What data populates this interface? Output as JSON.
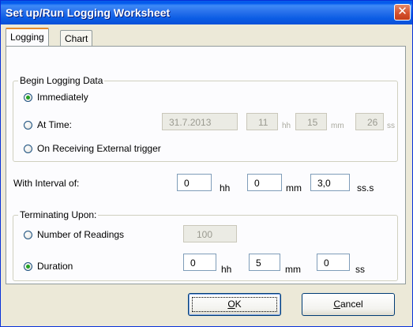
{
  "window": {
    "title": "Set up/Run Logging Worksheet",
    "close_glyph": "✕",
    "close_icon": "close-icon"
  },
  "tabs": [
    {
      "label": "Logging",
      "active": true
    },
    {
      "label": "Chart",
      "active": false
    }
  ],
  "begin_group": {
    "legend": "Begin Logging Data",
    "options": [
      {
        "label": "Immediately",
        "selected": true
      },
      {
        "label": "At Time:",
        "selected": false
      },
      {
        "label": "On Receiving External trigger",
        "selected": false
      }
    ],
    "at_time": {
      "date": "31.7.2013",
      "hh": "11",
      "hh_unit": "hh",
      "mm": "15",
      "mm_unit": "mm",
      "ss": "26",
      "ss_unit": "ss"
    }
  },
  "interval": {
    "label": "With Interval of:",
    "hh": "0",
    "hh_unit": "hh",
    "mm": "0",
    "mm_unit": "mm",
    "ss": "3,0",
    "ss_unit": "ss.s"
  },
  "terminate_group": {
    "legend": "Terminating Upon:",
    "options": [
      {
        "label": "Number of Readings",
        "selected": false
      },
      {
        "label": "Duration",
        "selected": true
      }
    ],
    "readings": "100",
    "duration": {
      "hh": "0",
      "hh_unit": "hh",
      "mm": "5",
      "mm_unit": "mm",
      "ss": "0",
      "ss_unit": "ss"
    }
  },
  "buttons": {
    "ok_accel": "O",
    "ok_rest": "K",
    "cancel_accel": "C",
    "cancel_rest": "ancel"
  },
  "colors": {
    "title_bar": "#0a5ee8",
    "close_button": "#d5522f",
    "dialog_face": "#ece9d8",
    "active_tab_accent": "#e68b2c",
    "radio_dot": "#21a121"
  }
}
